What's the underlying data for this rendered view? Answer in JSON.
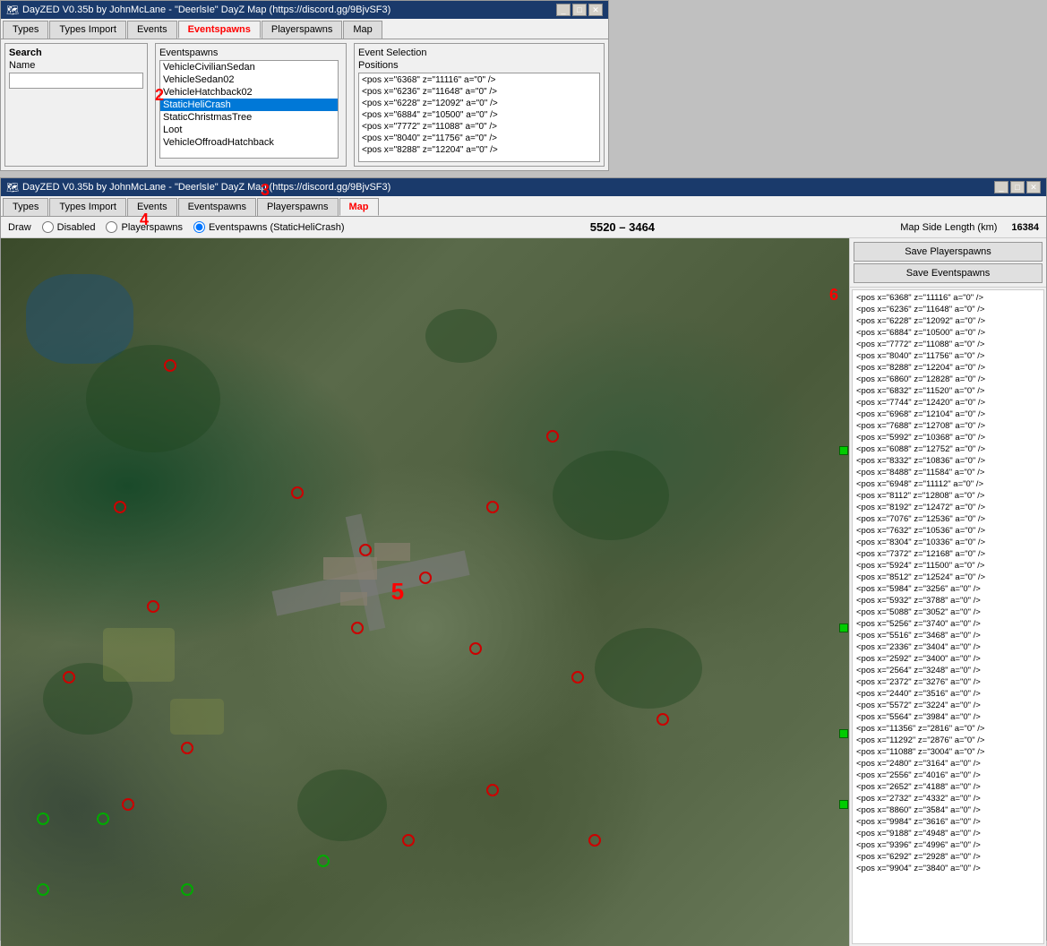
{
  "app": {
    "title": "DayZED V0.35b by JohnMcLane - \"DeerlsIe\" DayZ Map (https://discord.gg/9BjvSF3)",
    "icon": "dayzed-icon"
  },
  "window1": {
    "title": "DayZED V0.35b by JohnMcLane - \"DeerlsIe\" DayZ Map (https://discord.gg/9BjvSF3)"
  },
  "window2": {
    "title": "DayZED V0.35b by JohnMcLane - \"DeerlsIe\" DayZ Map (https://discord.gg/9BjvSF3)"
  },
  "tabs": {
    "types": "Types",
    "typesImport": "Types Import",
    "events": "Events",
    "eventspawns": "Eventspawns",
    "playerspawns": "Playerspawns",
    "map": "Map"
  },
  "search": {
    "label": "Search",
    "nameLabel": "Name",
    "placeholder": ""
  },
  "eventspawnsPanel": {
    "title": "Eventspawns",
    "items": [
      "VehicleCivilianSedan",
      "VehicleSedan02",
      "VehicleHatchback02",
      "StaticHeliCrash",
      "StaticChristmasTree",
      "Loot",
      "VehicleOffroadHatchback"
    ],
    "selected": "StaticHeliCrash"
  },
  "eventSelection": {
    "title": "Event Selection",
    "positionsLabel": "Positions",
    "positions": [
      "<pos x=\"6368\" z=\"11116\" a=\"0\" />",
      "<pos x=\"6236\" z=\"11648\" a=\"0\" />",
      "<pos x=\"6228\" z=\"12092\" a=\"0\" />",
      "<pos x=\"6884\" z=\"10500\" a=\"0\" />",
      "<pos x=\"7772\" z=\"11088\" a=\"0\" />",
      "<pos x=\"8040\" z=\"11756\" a=\"0\" />",
      "<pos x=\"8288\" z=\"12204\" a=\"0\" />"
    ]
  },
  "draw": {
    "label": "Draw",
    "options": {
      "disabled": "Disabled",
      "playerspawns": "Playerspawns",
      "eventspawns": "Eventspawns (StaticHeliCrash)"
    },
    "selected": "eventspawns"
  },
  "coords": "5520 – 3464",
  "mapSideLength": {
    "label": "Map Side Length (km)",
    "value": "16384"
  },
  "buttons": {
    "savePlayerspawns": "Save Playerspawns",
    "saveEventspawns": "Save Eventspawns"
  },
  "rightPanelPositions": [
    "<pos x=\"6368\" z=\"11116\" a=\"0\" />",
    "<pos x=\"6236\" z=\"11648\" a=\"0\" />",
    "<pos x=\"6228\" z=\"12092\" a=\"0\" />",
    "<pos x=\"6884\" z=\"10500\" a=\"0\" />",
    "<pos x=\"7772\" z=\"11088\" a=\"0\" />",
    "<pos x=\"8040\" z=\"11756\" a=\"0\" />",
    "<pos x=\"8288\" z=\"12204\" a=\"0\" />",
    "<pos x=\"6860\" z=\"12828\" a=\"0\" />",
    "<pos x=\"6832\" z=\"11520\" a=\"0\" />",
    "<pos x=\"7744\" z=\"12420\" a=\"0\" />",
    "<pos x=\"6968\" z=\"12104\" a=\"0\" />",
    "<pos x=\"7688\" z=\"12708\" a=\"0\" />",
    "<pos x=\"5992\" z=\"10368\" a=\"0\" />",
    "<pos x=\"6088\" z=\"12752\" a=\"0\" />",
    "<pos x=\"8332\" z=\"10836\" a=\"0\" />",
    "<pos x=\"8488\" z=\"11584\" a=\"0\" />",
    "<pos x=\"6948\" z=\"11112\" a=\"0\" />",
    "<pos x=\"8112\" z=\"12808\" a=\"0\" />",
    "<pos x=\"8192\" z=\"12472\" a=\"0\" />",
    "<pos x=\"7076\" z=\"12536\" a=\"0\" />",
    "<pos x=\"7632\" z=\"10536\" a=\"0\" />",
    "<pos x=\"8304\" z=\"10336\" a=\"0\" />",
    "<pos x=\"7372\" z=\"12168\" a=\"0\" />",
    "<pos x=\"5924\" z=\"11500\" a=\"0\" />",
    "<pos x=\"8512\" z=\"12524\" a=\"0\" />",
    "<pos x=\"5984\" z=\"3256\" a=\"0\" />",
    "<pos x=\"5932\" z=\"3788\" a=\"0\" />",
    "<pos x=\"5088\" z=\"3052\" a=\"0\" />",
    "<pos x=\"5256\" z=\"3740\" a=\"0\" />",
    "<pos x=\"5516\" z=\"3468\" a=\"0\" />",
    "<pos x=\"2336\" z=\"3404\" a=\"0\" />",
    "<pos x=\"2592\" z=\"3400\" a=\"0\" />",
    "<pos x=\"2564\" z=\"3248\" a=\"0\" />",
    "<pos x=\"2372\" z=\"3276\" a=\"0\" />",
    "<pos x=\"2440\" z=\"3516\" a=\"0\" />",
    "<pos x=\"5572\" z=\"3224\" a=\"0\" />",
    "<pos x=\"5564\" z=\"3984\" a=\"0\" />",
    "<pos x=\"11356\" z=\"2816\" a=\"0\" />",
    "<pos x=\"11292\" z=\"2876\" a=\"0\" />",
    "<pos x=\"11088\" z=\"3004\" a=\"0\" />",
    "<pos x=\"2480\" z=\"3164\" a=\"0\" />",
    "<pos x=\"2556\" z=\"4016\" a=\"0\" />",
    "<pos x=\"2652\" z=\"4188\" a=\"0\" />",
    "<pos x=\"2732\" z=\"4332\" a=\"0\" />",
    "<pos x=\"8860\" z=\"3584\" a=\"0\" />",
    "<pos x=\"9984\" z=\"3616\" a=\"0\" />",
    "<pos x=\"9188\" z=\"4948\" a=\"0\" />",
    "<pos x=\"9396\" z=\"4996\" a=\"0\" />",
    "<pos x=\"6292\" z=\"2928\" a=\"0\" />",
    "<pos x=\"9904\" z=\"3840\" a=\"0\" />"
  ],
  "annotations": {
    "num2": "2",
    "num3": "3",
    "num4": "4",
    "num5": "5",
    "num6": "6"
  },
  "titleControls": {
    "minimize": "_",
    "maximize": "□",
    "close": "✕"
  }
}
